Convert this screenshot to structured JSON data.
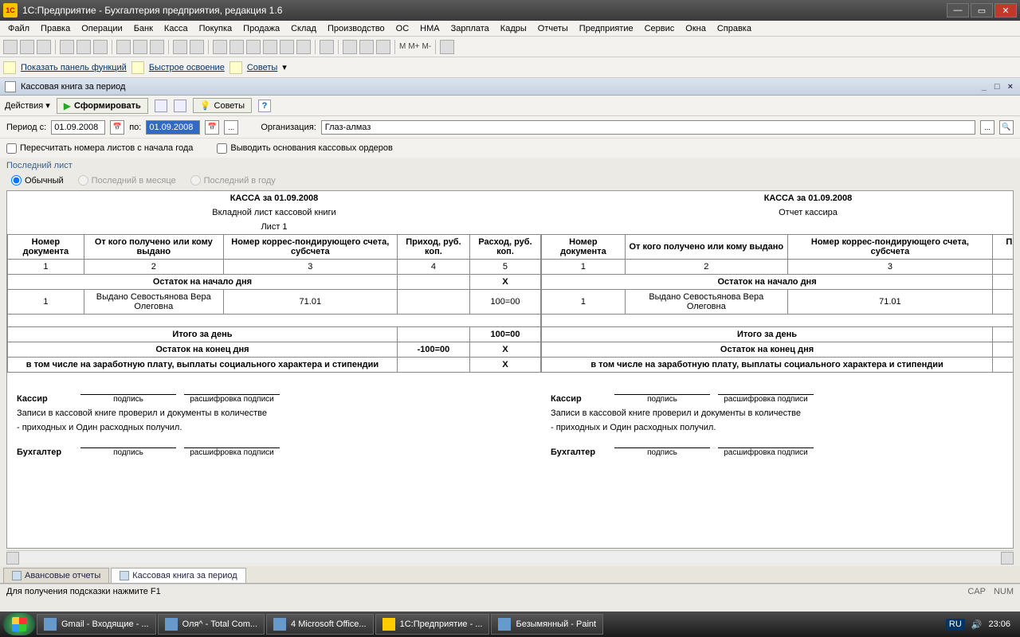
{
  "titlebar": {
    "title": "1С:Предприятие - Бухгалтерия предприятия, редакция 1.6"
  },
  "menubar": [
    "Файл",
    "Правка",
    "Операции",
    "Банк",
    "Касса",
    "Покупка",
    "Продажа",
    "Склад",
    "Производство",
    "ОС",
    "НМА",
    "Зарплата",
    "Кадры",
    "Отчеты",
    "Предприятие",
    "Сервис",
    "Окна",
    "Справка"
  ],
  "toolbar2": {
    "show_panel": "Показать панель функций",
    "fast": "Быстрое освоение",
    "tips": "Советы"
  },
  "subhead": {
    "title": "Кассовая книга за период"
  },
  "actionbar": {
    "actions": "Действия",
    "form": "Сформировать",
    "tips": "Советы"
  },
  "toolbarM": {
    "m": "M",
    "mp": "M+",
    "mm": "M-"
  },
  "filter": {
    "period_from_lbl": "Период с:",
    "from": "01.09.2008",
    "to_lbl": "по:",
    "to": "01.09.2008",
    "dots": "...",
    "org_lbl": "Организация:",
    "org": "Глаз-алмаз"
  },
  "checks": {
    "recalc": "Пересчитать номера листов с начала года",
    "show_basis": "Выводить основания кассовых ордеров"
  },
  "group": {
    "title": "Последний лист",
    "r1": "Обычный",
    "r2": "Последний в месяце",
    "r3": "Последний в году"
  },
  "report": {
    "title": "КАССА за 01.09.2008",
    "sub_left": "Вкладной лист кассовой книги",
    "sub_right": "Отчет кассира",
    "sheet": "Лист 1",
    "h": {
      "c1": "Номер документа",
      "c2": "От кого получено или кому выдано",
      "c3": "Номер коррес-пондирующего счета, субсчета",
      "c4": "Приход, руб. коп.",
      "c5": "Расход, руб. коп."
    },
    "nums": {
      "n1": "1",
      "n2": "2",
      "n3": "3",
      "n4": "4",
      "n5": "5"
    },
    "rows": {
      "start": "Остаток на начало дня",
      "x": "X",
      "d1_num": "1",
      "d1_who": "Выдано Севостьянова Вера Олеговна",
      "d1_acc": "71.01",
      "d1_exp": "100=00",
      "day_total": "Итого за день",
      "day_exp": "100=00",
      "end": "Остаток на конец  дня",
      "end_in": "-100=00",
      "salary": "в том числе на заработную плату, выплаты социального характера и стипендии"
    },
    "sig": {
      "cashier": "Кассир",
      "acc": "Бухгалтер",
      "sign": "подпись",
      "decode": "расшифровка подписи",
      "text1": "Записи в кассовой книге проверил и документы в количестве",
      "text2": "- приходных и Один расходных получил."
    }
  },
  "bottabs": {
    "t1": "Авансовые отчеты",
    "t2": "Кассовая книга за период"
  },
  "status": {
    "hint": "Для получения подсказки нажмите F1",
    "cap": "CAP",
    "num": "NUM"
  },
  "taskbar": {
    "b1": "Gmail - Входящие - ...",
    "b2": "Оля^ - Total Com...",
    "b3": "4 Microsoft Office...",
    "b4": "1С:Предприятие - ...",
    "b5": "Безымянный - Paint",
    "lang": "RU",
    "time": "23:06"
  }
}
